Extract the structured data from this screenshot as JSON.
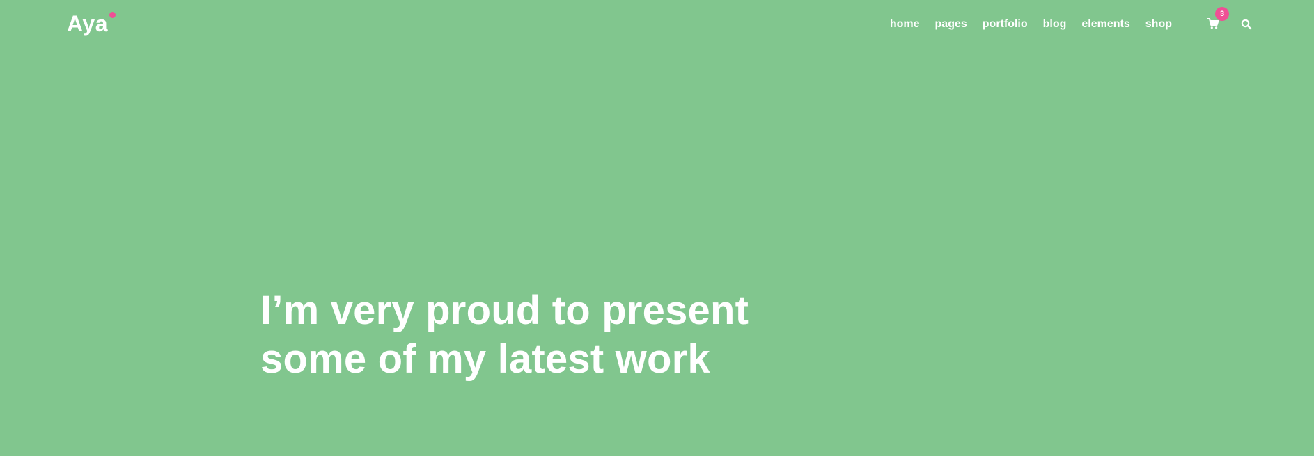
{
  "header": {
    "logo_text": "Aya",
    "nav": [
      {
        "label": "home",
        "active": true
      },
      {
        "label": "pages",
        "active": false
      },
      {
        "label": "portfolio",
        "active": false
      },
      {
        "label": "blog",
        "active": false
      },
      {
        "label": "elements",
        "active": false
      },
      {
        "label": "shop",
        "active": false
      }
    ],
    "cart_icon": "shopping-cart-icon",
    "cart_count": "3",
    "search_icon": "search-icon"
  },
  "hero": {
    "line1": "I’m very proud to present",
    "line2": "some of my latest work"
  },
  "colors": {
    "background": "#81c68e",
    "text": "#ffffff",
    "accent_pink": "#ef4f95",
    "nav_underline": "#ffd75c"
  }
}
